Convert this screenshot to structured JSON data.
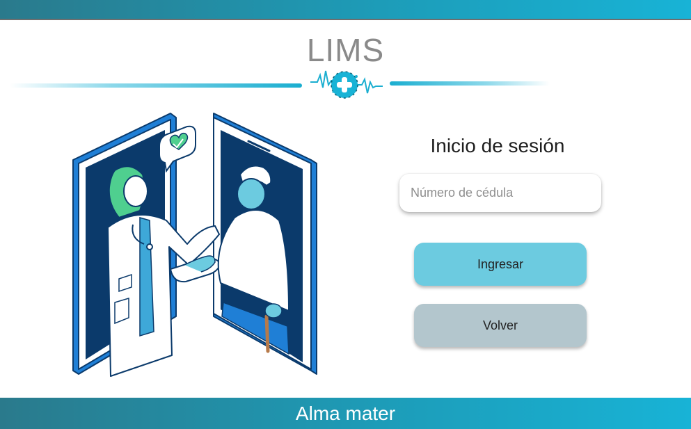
{
  "header": {
    "title": "LIMS"
  },
  "logo": {
    "icon": "medical-cross-heartbeat-icon",
    "accent": "#18b3d6"
  },
  "illustration": {
    "icon": "telemedicine-doctor-patient-illustration"
  },
  "login": {
    "title": "Inicio de sesión",
    "id_placeholder": "Número de cédula",
    "id_value": "",
    "submit_label": "Ingresar",
    "back_label": "Volver"
  },
  "footer": {
    "text": "Alma mater"
  },
  "colors": {
    "bar_gradient_start": "#2a7a8c",
    "bar_gradient_end": "#18b3d6",
    "submit_button": "#6ccbe0",
    "back_button": "#b3c6cd",
    "illustration_blue": "#1f7fd6",
    "illustration_navy": "#0b3a6b",
    "doctor_hair": "#4fcf8f"
  }
}
